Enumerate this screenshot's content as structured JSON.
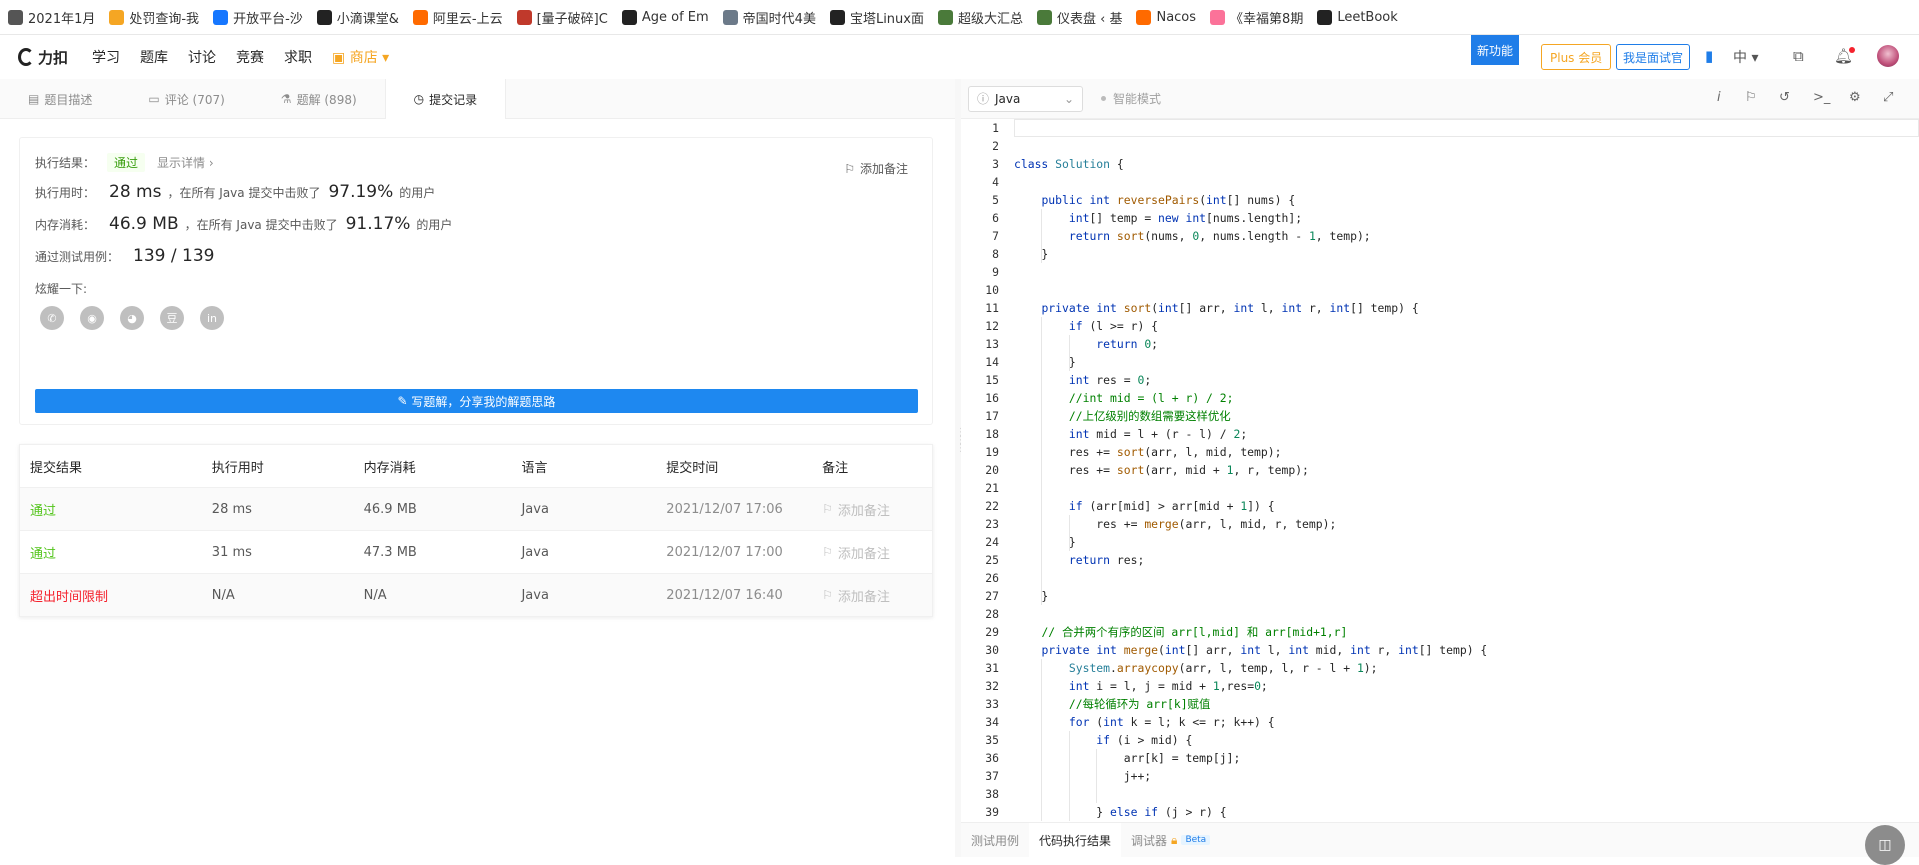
{
  "bookmarks": [
    {
      "label": "2021年1月",
      "icon": "chain-icon",
      "color": "#555555"
    },
    {
      "label": "处罚查询-我",
      "icon": "pinwheel-icon",
      "color": "#f5a623"
    },
    {
      "label": "开放平台-沙",
      "icon": "alipay-icon",
      "color": "#1677ff"
    },
    {
      "label": "小滴课堂&",
      "icon": "book-icon",
      "color": "#222222"
    },
    {
      "label": "阿里云-上云",
      "icon": "aliyun-icon",
      "color": "#ff6a00"
    },
    {
      "label": "[量子破碎]C",
      "icon": "quantum-icon",
      "color": "#c0392b"
    },
    {
      "label": "Age of Em",
      "icon": "age-icon",
      "color": "#222222"
    },
    {
      "label": "帝国时代4美",
      "icon": "empire-icon",
      "color": "#6c7a89"
    },
    {
      "label": "宝塔Linux面",
      "icon": "bt-icon",
      "color": "#222222"
    },
    {
      "label": "超级大汇总",
      "icon": "leaf-icon",
      "color": "#4a7a3a"
    },
    {
      "label": "仪表盘 ‹ 基",
      "icon": "leaf-icon",
      "color": "#4a7a3a"
    },
    {
      "label": "Nacos",
      "icon": "aliyun-icon",
      "color": "#ff6a00"
    },
    {
      "label": "《幸福第8期",
      "icon": "bilibili-icon",
      "color": "#fb7299"
    },
    {
      "label": "LeetBook",
      "icon": "leetcode-icon",
      "color": "#222222"
    }
  ],
  "topnav": {
    "logo": "力扣",
    "items": [
      "学习",
      "题库",
      "讨论",
      "竞赛",
      "求职"
    ],
    "shop": "商店",
    "new_feature": "新功能",
    "plus": "Plus 会员",
    "interviewer": "我是面试官",
    "lang": "中"
  },
  "tabs": [
    {
      "label": "题目描述",
      "icon": "doc-icon"
    },
    {
      "label": "评论 (707)",
      "icon": "comment-icon"
    },
    {
      "label": "题解 (898)",
      "icon": "flask-icon"
    },
    {
      "label": "提交记录",
      "icon": "clock-icon"
    }
  ],
  "result": {
    "result_label": "执行结果：",
    "status": "通过",
    "detail": "显示详情 ›",
    "add_note": "添加备注",
    "time_label": "执行用时：",
    "time_value": "28 ms",
    "time_text": "，在所有 Java 提交中击败了",
    "time_pct": "97.19%",
    "users": "的用户",
    "mem_label": "内存消耗：",
    "mem_value": "46.9 MB",
    "mem_text": "，在所有 Java 提交中击败了",
    "mem_pct": "91.17%",
    "cases_label": "通过测试用例：",
    "cases_value": "139 / 139",
    "share_label": "炫耀一下:",
    "share_icons": [
      "wechat-icon",
      "weibo-icon",
      "qq-icon",
      "douban-icon",
      "linkedin-icon"
    ],
    "share_glyphs": [
      "✆",
      "◉",
      "◕",
      "豆",
      "in"
    ],
    "write_btn": "写题解，分享我的解题思路"
  },
  "table": {
    "headers": [
      "提交结果",
      "执行用时",
      "内存消耗",
      "语言",
      "提交时间",
      "备注"
    ],
    "rows": [
      {
        "status": "通过",
        "time": "28 ms",
        "mem": "46.9 MB",
        "lang": "Java",
        "date": "2021/12/07 17:06",
        "note": "添加备注"
      },
      {
        "status": "通过",
        "time": "31 ms",
        "mem": "47.3 MB",
        "lang": "Java",
        "date": "2021/12/07 17:00",
        "note": "添加备注"
      },
      {
        "status": "超出时间限制",
        "time": "N/A",
        "mem": "N/A",
        "lang": "Java",
        "date": "2021/12/07 16:40",
        "note": "添加备注"
      }
    ]
  },
  "editor": {
    "language": "Java",
    "smart_mode": "智能模式",
    "bottom_tabs": [
      "测试用例",
      "代码执行结果",
      "调试器"
    ],
    "beta": "Beta",
    "code": [
      "",
      "",
      "class Solution {",
      "",
      "    public int reversePairs(int[] nums) {",
      "        int[] temp = new int[nums.length];",
      "        return sort(nums, 0, nums.length - 1, temp);",
      "    }",
      "",
      "",
      "    private int sort(int[] arr, int l, int r, int[] temp) {",
      "        if (l >= r) {",
      "            return 0;",
      "        }",
      "        int res = 0;",
      "        //int mid = (l + r) / 2;",
      "        //上亿级别的数组需要这样优化",
      "        int mid = l + (r - l) / 2;",
      "        res += sort(arr, l, mid, temp);",
      "        res += sort(arr, mid + 1, r, temp);",
      "",
      "        if (arr[mid] > arr[mid + 1]) {",
      "            res += merge(arr, l, mid, r, temp);",
      "        }",
      "        return res;",
      "",
      "    }",
      "",
      "    // 合并两个有序的区间 arr[l,mid] 和 arr[mid+1,r]",
      "    private int merge(int[] arr, int l, int mid, int r, int[] temp) {",
      "        System.arraycopy(arr, l, temp, l, r - l + 1);",
      "        int i = l, j = mid + 1,res=0;",
      "        //每轮循环为 arr[k]赋值",
      "        for (int k = l; k <= r; k++) {",
      "            if (i > mid) {",
      "                arr[k] = temp[j];",
      "                j++;",
      "",
      "            } else if (j > r) {"
    ]
  }
}
